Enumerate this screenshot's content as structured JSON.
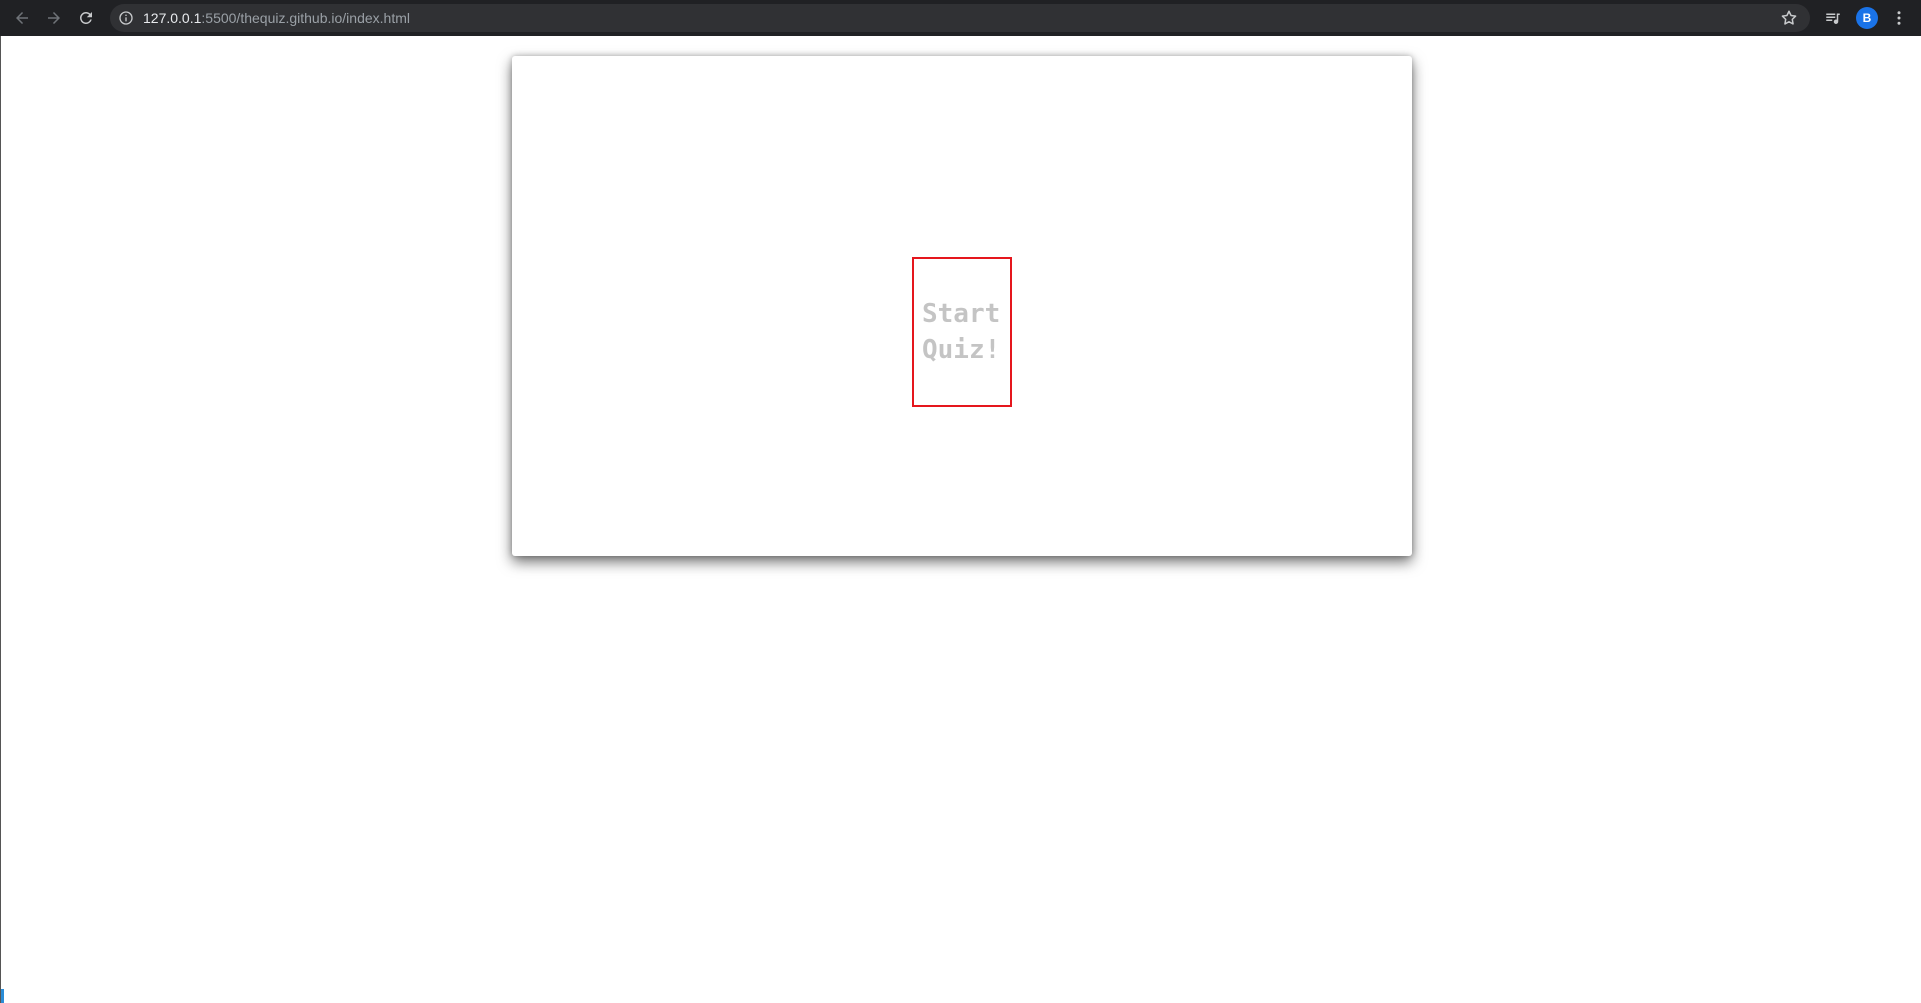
{
  "browser": {
    "url_host": "127.0.0.1",
    "url_rest": ":5500/thequiz.github.io/index.html",
    "profile_initial": "B"
  },
  "icons": {
    "back": "back-arrow-icon",
    "forward": "forward-arrow-icon",
    "reload": "reload-icon",
    "info": "info-icon",
    "bookmark": "star-icon",
    "media": "media-queue-icon",
    "menu": "kebab-menu-icon"
  },
  "quiz": {
    "start_label": "Start Quiz!"
  },
  "colors": {
    "start_border": "#e5161d",
    "start_text": "#c4c4c4",
    "avatar": "#1a73e8"
  }
}
